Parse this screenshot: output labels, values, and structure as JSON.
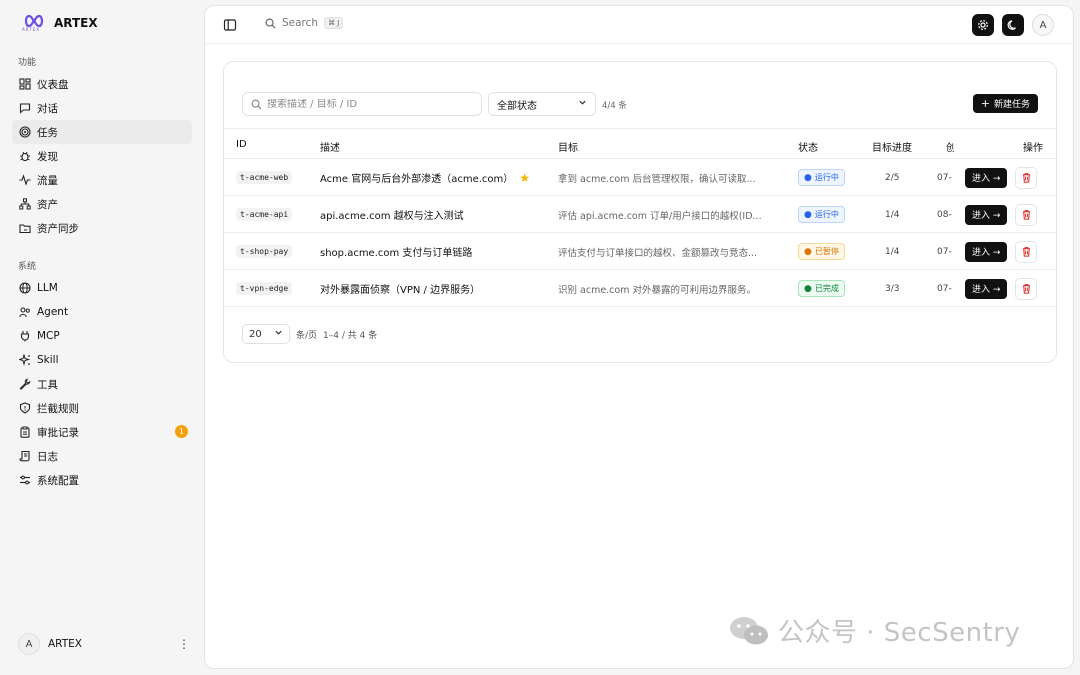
{
  "brand": {
    "name": "ARTEX",
    "sub": "ARTEX"
  },
  "sidebar": {
    "section1": "功能",
    "section2": "系统",
    "items1": [
      {
        "label": "仪表盘",
        "icon": "dashboard-icon"
      },
      {
        "label": "对话",
        "icon": "chat-icon"
      },
      {
        "label": "任务",
        "icon": "target-icon",
        "active": true
      },
      {
        "label": "发现",
        "icon": "bug-icon"
      },
      {
        "label": "流量",
        "icon": "activity-icon"
      },
      {
        "label": "资产",
        "icon": "network-icon"
      },
      {
        "label": "资产同步",
        "icon": "folder-sync-icon"
      }
    ],
    "items2": [
      {
        "label": "LLM",
        "icon": "globe-icon"
      },
      {
        "label": "Agent",
        "icon": "bot-icon"
      },
      {
        "label": "MCP",
        "icon": "plug-icon"
      },
      {
        "label": "Skill",
        "icon": "sparkles-icon"
      },
      {
        "label": "工具",
        "icon": "wrench-icon"
      },
      {
        "label": "拦截规则",
        "icon": "shield-icon"
      },
      {
        "label": "审批记录",
        "icon": "clipboard-icon",
        "badge": "1"
      },
      {
        "label": "日志",
        "icon": "scroll-icon"
      },
      {
        "label": "系统配置",
        "icon": "sliders-icon"
      }
    ],
    "user": {
      "initial": "A",
      "name": "ARTEX"
    }
  },
  "topbar": {
    "search_label": "Search",
    "shortcut": "⌘ J",
    "avatar_initial": "A"
  },
  "toolbar": {
    "search_placeholder": "搜索描述 / 目标 / ID",
    "status_value": "全部状态",
    "count": "4/4 条",
    "new_label": "新建任务"
  },
  "table": {
    "headers": {
      "id": "ID",
      "desc": "描述",
      "target": "目标",
      "status": "状态",
      "progress": "目标进度",
      "created": "创",
      "actions": "操作"
    },
    "rows": [
      {
        "id": "t-acme-web",
        "desc": "Acme 官网与后台外部渗透（acme.com）",
        "starred": true,
        "target": "拿到 acme.com 后台管理权限，确认可读取...",
        "status": "运行中",
        "status_kind": "running",
        "progress": "2/5",
        "created": "07-"
      },
      {
        "id": "t-acme-api",
        "desc": "api.acme.com 越权与注入测试",
        "starred": false,
        "target": "评估 api.acme.com 订单/用户接口的越权(ID...",
        "status": "运行中",
        "status_kind": "running",
        "progress": "1/4",
        "created": "08-"
      },
      {
        "id": "t-shop-pay",
        "desc": "shop.acme.com 支付与订单链路",
        "starred": false,
        "target": "评估支付与订单接口的越权、金额篡改与竞态...",
        "status": "已暂停",
        "status_kind": "paused",
        "progress": "1/4",
        "created": "07-"
      },
      {
        "id": "t-vpn-edge",
        "desc": "对外暴露面侦察（VPN / 边界服务）",
        "starred": false,
        "target": "识别 acme.com 对外暴露的可利用边界服务。",
        "status": "已完成",
        "status_kind": "done",
        "progress": "3/3",
        "created": "07-"
      }
    ],
    "enter_label": "进入 →"
  },
  "pager": {
    "size": "20",
    "per": "条/页",
    "range": "1–4 / 共 4 条"
  },
  "watermark": "公众号 · SecSentry",
  "colors": {
    "running": {
      "fg": "#2563eb",
      "bg": "#eff5ff",
      "border": "#bcd3fb"
    },
    "paused": {
      "fg": "#d97706",
      "bg": "#fff7e6",
      "border": "#f8d79a"
    },
    "done": {
      "fg": "#15803d",
      "bg": "#ecfbf1",
      "border": "#a7e3bb"
    }
  }
}
